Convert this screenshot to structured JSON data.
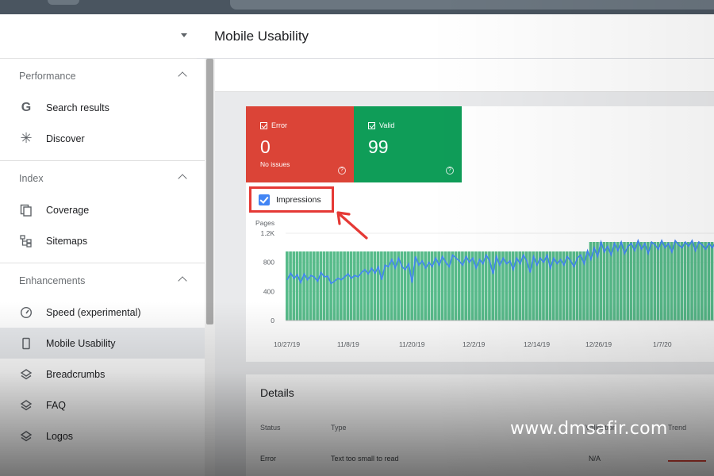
{
  "header": {
    "title": "Mobile Usability"
  },
  "sidebar": {
    "sections": [
      {
        "title": "Performance",
        "items": [
          {
            "label": "Search results",
            "icon": "google-g-icon"
          },
          {
            "label": "Discover",
            "icon": "asterisk-icon"
          }
        ]
      },
      {
        "title": "Index",
        "items": [
          {
            "label": "Coverage",
            "icon": "copy-pages-icon"
          },
          {
            "label": "Sitemaps",
            "icon": "sitemap-icon"
          }
        ]
      },
      {
        "title": "Enhancements",
        "items": [
          {
            "label": "Speed (experimental)",
            "icon": "gauge-icon"
          },
          {
            "label": "Mobile Usability",
            "icon": "smartphone-icon",
            "active": true
          },
          {
            "label": "Breadcrumbs",
            "icon": "layers-icon"
          },
          {
            "label": "FAQ",
            "icon": "layers-icon"
          },
          {
            "label": "Logos",
            "icon": "layers-icon"
          }
        ]
      }
    ]
  },
  "summary": {
    "error": {
      "label": "Error",
      "value": "0",
      "sub": "No issues",
      "color": "#db4437"
    },
    "valid": {
      "label": "Valid",
      "value": "99",
      "color": "#0f9d58"
    }
  },
  "impressions": {
    "label": "Impressions",
    "checked": true
  },
  "chart_data": {
    "type": "bar",
    "ylabel": "Pages",
    "yticks": [
      "0",
      "400",
      "800",
      "1.2K"
    ],
    "ylim": [
      0,
      1200
    ],
    "xticks": [
      "10/27/19",
      "11/8/19",
      "11/20/19",
      "12/2/19",
      "12/14/19",
      "12/26/19",
      "1/7/20"
    ],
    "bar_color": "#57bb8a",
    "line_color": "#4285f4",
    "series": [
      {
        "type": "bar",
        "values": [
          950,
          950,
          950,
          950,
          950,
          950,
          950,
          950,
          950,
          950,
          950,
          950,
          950,
          950,
          950,
          950,
          950,
          950,
          950,
          950,
          950,
          950,
          950,
          950,
          950,
          950,
          950,
          950,
          950,
          950,
          950,
          950,
          950,
          950,
          950,
          950,
          950,
          950,
          950,
          950,
          950,
          950,
          950,
          950,
          950,
          950,
          950,
          950,
          950,
          950,
          950,
          950,
          950,
          950,
          950,
          950,
          950,
          950,
          950,
          950,
          950,
          950,
          950,
          950,
          950,
          950,
          950,
          950,
          950,
          950,
          950,
          950,
          950,
          950,
          950,
          950,
          950,
          950,
          950,
          950,
          950,
          950,
          950,
          950,
          950,
          950,
          950,
          950,
          950,
          950,
          1080,
          1080,
          1080,
          1080,
          1080,
          1080,
          1080,
          1080,
          1080,
          1080,
          1080,
          1080,
          1080,
          1080,
          1080,
          1080,
          1080,
          1080,
          1080,
          1080,
          1080,
          1080,
          1080,
          1080,
          1080,
          1080,
          1080,
          1080,
          1080,
          1080,
          1080,
          1080,
          1080,
          1080,
          1080,
          1080,
          1080
        ]
      },
      {
        "type": "line",
        "values": [
          560,
          650,
          580,
          630,
          520,
          640,
          560,
          620,
          600,
          540,
          660,
          600,
          610,
          510,
          540,
          580,
          560,
          600,
          640,
          580,
          620,
          600,
          660,
          700,
          640,
          720,
          650,
          740,
          560,
          760,
          740,
          840,
          720,
          860,
          740,
          700,
          780,
          520,
          880,
          760,
          820,
          720,
          800,
          740,
          860,
          760,
          880,
          800,
          740,
          900,
          860,
          820,
          760,
          880,
          800,
          860,
          720,
          840,
          780,
          900,
          820,
          640,
          880,
          760,
          860,
          780,
          820,
          700,
          860,
          780,
          900,
          820,
          660,
          880,
          760,
          860,
          800,
          900,
          720,
          860,
          780,
          840,
          760,
          880,
          820,
          740,
          860,
          900,
          780,
          960,
          840,
          1000,
          880,
          1080,
          940,
          1020,
          900,
          1060,
          960,
          1080,
          920,
          1020,
          1060,
          960,
          1100,
          980,
          1060,
          920,
          1080,
          1040,
          980,
          1100,
          1000,
          1060,
          940,
          1100,
          1040,
          1000,
          1080,
          1020,
          1100,
          960,
          1080,
          1040,
          980,
          1060,
          1000,
          1080,
          1040,
          1080,
          960,
          1060
        ]
      }
    ]
  },
  "details": {
    "title": "Details",
    "columns": {
      "status": "Status",
      "type": "Type",
      "validation": "Validation",
      "trend": "Trend"
    },
    "row": {
      "status": "Error",
      "type": "Text too small to read",
      "validation": "N/A"
    }
  },
  "watermark": "www.dmsafir.com"
}
